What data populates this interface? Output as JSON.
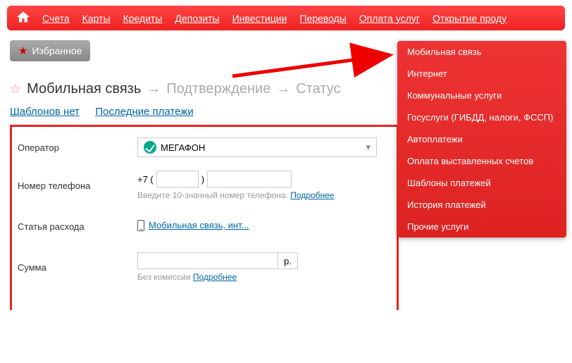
{
  "nav": {
    "items": [
      "Счета",
      "Карты",
      "Кредиты",
      "Депозиты",
      "Инвестиции",
      "Переводы",
      "Оплата услуг",
      "Открытие проду"
    ]
  },
  "favorites": {
    "label": "Избранное"
  },
  "breadcrumb": {
    "step1": "Мобильная связь",
    "step2": "Подтверждение",
    "step3": "Статус"
  },
  "subtabs": {
    "none": "Шаблонов нет",
    "recent": "Последние платежи"
  },
  "form": {
    "operator_label": "Оператор",
    "operator_value": "МЕГАФОН",
    "phone_label": "Номер телефона",
    "phone_prefix": "+7 (",
    "phone_paren": ")",
    "phone_hint": "Введите 10-значный номер телефона.",
    "phone_more": "Подробнее",
    "expense_label": "Статья расхода",
    "expense_link": "Мобильная связь, инт...",
    "sum_label": "Сумма",
    "sum_currency": "р.",
    "sum_hint": "Без комиссии",
    "sum_more": "Подробнее"
  },
  "dropdown": {
    "items": [
      "Мобильная связь",
      "Интернет",
      "Коммунальные услуги",
      "Госуслуги (ГИБДД, налоги, ФССП)",
      "Автоплатежи",
      "Оплата выставленных счетов",
      "Шаблоны платежей",
      "История платежей",
      "Прочие услуги"
    ]
  }
}
